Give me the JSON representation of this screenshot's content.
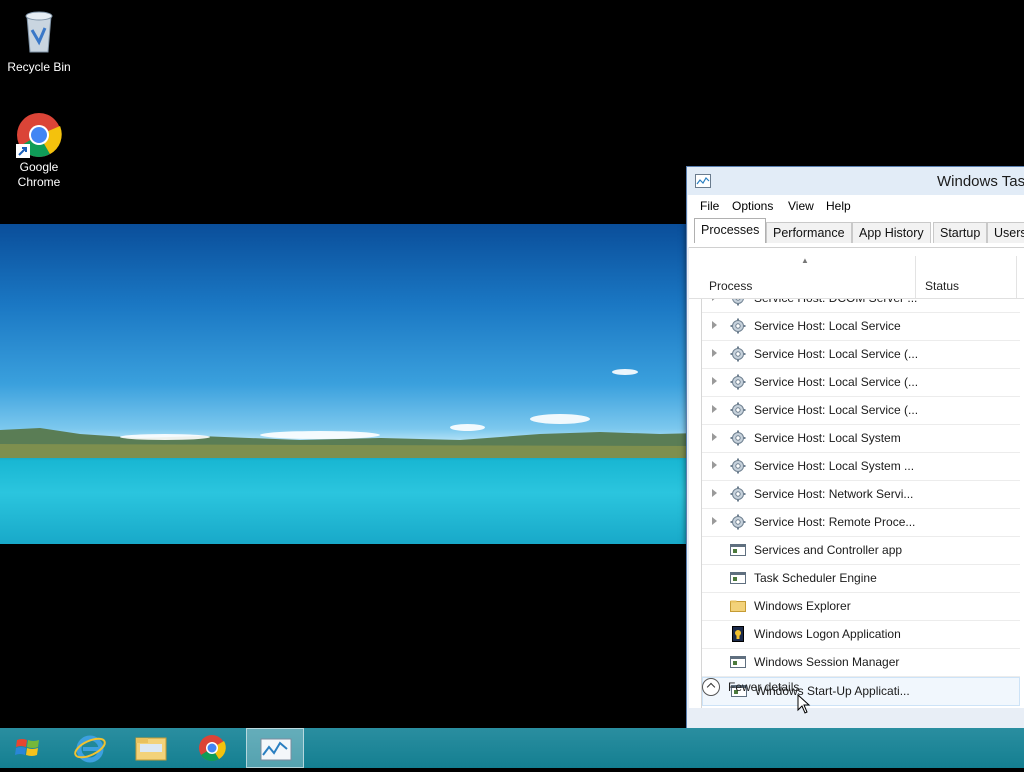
{
  "desktop": {
    "icons": [
      {
        "label": "Recycle Bin",
        "icon": "recycle-bin-icon"
      },
      {
        "label": "Google\nChrome",
        "label_line1": "Google",
        "label_line2": "Chrome",
        "icon": "chrome-icon"
      }
    ]
  },
  "window": {
    "title": "Windows Task Manager",
    "title_visible": "Windows Tas",
    "menu": [
      "File",
      "Options",
      "View",
      "Help"
    ],
    "tabs": [
      "Processes",
      "Performance",
      "App History",
      "Startup",
      "Users"
    ],
    "active_tab": "Processes",
    "columns": {
      "process": "Process",
      "status": "Status"
    },
    "processes": [
      {
        "label": "Service Host: DCOM Server ...",
        "icon": "gear-icon",
        "expandable": true
      },
      {
        "label": "Service Host: Local Service",
        "icon": "gear-icon",
        "expandable": true
      },
      {
        "label": "Service Host: Local Service (...",
        "icon": "gear-icon",
        "expandable": true
      },
      {
        "label": "Service Host: Local Service (...",
        "icon": "gear-icon",
        "expandable": true
      },
      {
        "label": "Service Host: Local Service (...",
        "icon": "gear-icon",
        "expandable": true
      },
      {
        "label": "Service Host: Local System",
        "icon": "gear-icon",
        "expandable": true
      },
      {
        "label": "Service Host: Local System ...",
        "icon": "gear-icon",
        "expandable": true
      },
      {
        "label": "Service Host: Network Servi...",
        "icon": "gear-icon",
        "expandable": true
      },
      {
        "label": "Service Host: Remote Proce...",
        "icon": "gear-icon",
        "expandable": true
      },
      {
        "label": "Services and Controller app",
        "icon": "app-window-icon",
        "expandable": false
      },
      {
        "label": "Task Scheduler Engine",
        "icon": "app-window-icon",
        "expandable": false
      },
      {
        "label": "Windows Explorer",
        "icon": "folder-icon",
        "expandable": false
      },
      {
        "label": "Windows Logon Application",
        "icon": "logon-icon",
        "expandable": false
      },
      {
        "label": "Windows Session Manager",
        "icon": "app-window-icon",
        "expandable": false
      },
      {
        "label": "Windows Start-Up Applicati...",
        "icon": "app-window-icon",
        "expandable": false,
        "hovered": true
      }
    ],
    "footer": {
      "fewer_details": "Fewer details"
    }
  },
  "taskbar": {
    "items": [
      {
        "name": "start-button",
        "icon": "windows-logo-icon"
      },
      {
        "name": "internet-explorer",
        "icon": "ie-icon"
      },
      {
        "name": "file-explorer",
        "icon": "folder-icon"
      },
      {
        "name": "google-chrome",
        "icon": "chrome-icon"
      },
      {
        "name": "task-manager",
        "icon": "task-manager-icon",
        "active": true
      }
    ]
  },
  "colors": {
    "taskbar": "#1a8a9c",
    "window_border": "#5a7fb0",
    "row_hover": "#f1f7fd"
  }
}
